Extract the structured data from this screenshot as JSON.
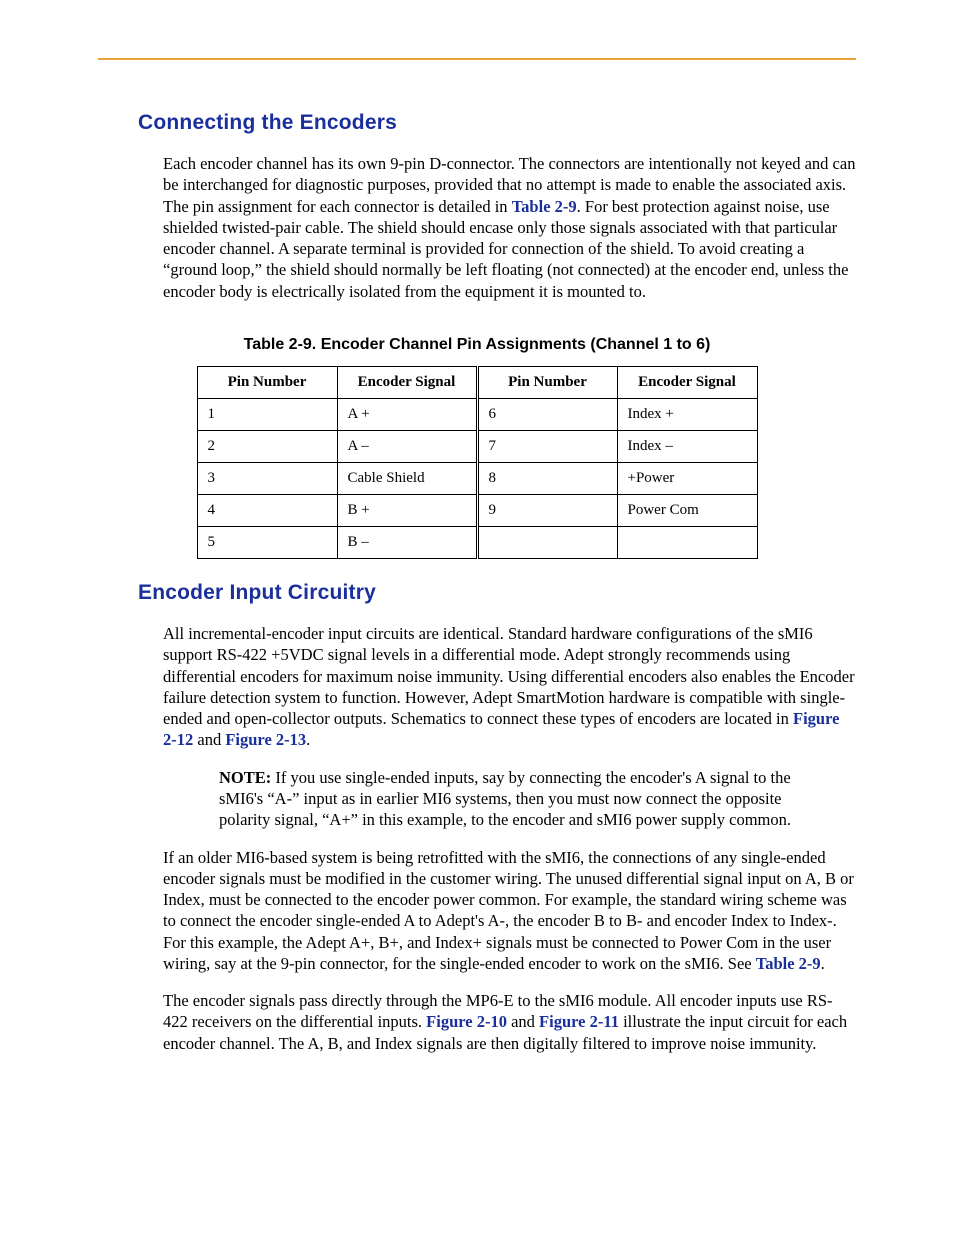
{
  "sections": {
    "connecting": {
      "heading": "Connecting the Encoders",
      "para1_a": "Each encoder channel has its own 9-pin D-connector. The connectors are intentionally not keyed and can be interchanged for diagnostic purposes, provided that no attempt is made to enable the associated axis. The pin assignment for each connector is detailed in ",
      "para1_link": "Table 2-9",
      "para1_b": ". For best protection against noise, use shielded twisted-pair cable. The shield should encase only those signals associated with that particular encoder channel. A separate terminal is provided for connection of the shield. To avoid creating a “ground loop,” the shield should normally be left floating (not connected) at the encoder end, unless the encoder body is electrically isolated from the equipment it is mounted to."
    },
    "table": {
      "caption": "Table 2-9. Encoder Channel Pin Assignments (Channel 1 to 6)",
      "headers": [
        "Pin Number",
        "Encoder Signal",
        "Pin Number",
        "Encoder Signal"
      ],
      "rows": [
        [
          "1",
          "A +",
          "6",
          "Index +"
        ],
        [
          "2",
          "A –",
          "7",
          "Index –"
        ],
        [
          "3",
          "Cable Shield",
          "8",
          "+Power"
        ],
        [
          "4",
          "B +",
          "9",
          "Power Com"
        ],
        [
          "5",
          "B –",
          "",
          ""
        ]
      ]
    },
    "circuitry": {
      "heading": "Encoder Input Circuitry",
      "para1_a": "All incremental-encoder input circuits are identical. Standard hardware configurations of the sMI6 support RS-422 +5VDC signal levels in a differential mode. Adept strongly recommends using differential encoders for maximum noise immunity. Using differential encoders also enables the Encoder failure detection system to function. However, Adept SmartMotion hardware is compatible with single-ended and open-collector outputs. Schematics to connect these types of encoders are located in ",
      "para1_link1": "Figure 2-12",
      "para1_mid": " and ",
      "para1_link2": "Figure 2-13",
      "para1_end": ".",
      "note_label": "NOTE:",
      "note_text": " If you use single-ended inputs, say by connecting the encoder's A signal to the sMI6's “A-” input as in earlier MI6 systems, then you must now connect the opposite polarity signal, “A+” in this example, to the encoder and sMI6 power supply common.",
      "para2_a": "If an older MI6-based system is being retrofitted with the sMI6, the connections of any single-ended encoder signals must be modified in the customer wiring. The unused differential signal input on A, B or Index, must be connected to the encoder power common. For example, the standard wiring scheme was to connect the encoder single-ended A to Adept's A-, the encoder B to B- and encoder Index to Index-. For this example, the Adept A+, B+, and Index+ signals must be connected to Power Com in the user wiring, say at the 9-pin connector, for the single-ended encoder to work on the sMI6. See ",
      "para2_link": "Table 2-9",
      "para2_end": ".",
      "para3_a": "The encoder signals pass directly through the MP6-E to the sMI6 module. All encoder inputs use RS-422 receivers on the differential inputs. ",
      "para3_link1": "Figure 2-10",
      "para3_mid": " and ",
      "para3_link2": "Figure 2-11",
      "para3_b": " illustrate the input circuit for each encoder channel. The A, B, and Index signals are then digitally filtered to improve noise immunity."
    }
  }
}
